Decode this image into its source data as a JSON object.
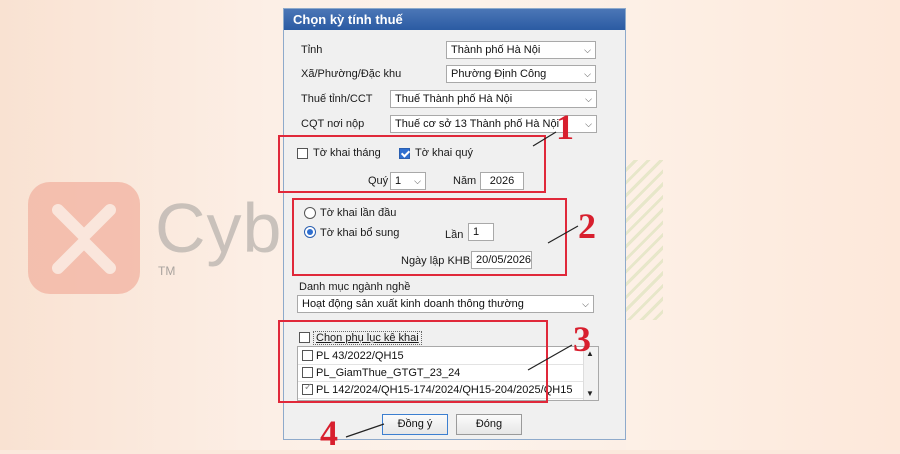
{
  "brand": {
    "name": "Cyber",
    "tm": "TM"
  },
  "dialog": {
    "title": "Chọn kỳ tính thuế",
    "fields": {
      "tinh": {
        "label": "Tỉnh",
        "value": "Thành phố Hà Nội"
      },
      "xa": {
        "label": "Xã/Phường/Đặc khu",
        "value": "Phường Định Công"
      },
      "thue": {
        "label": "Thuế tỉnh/CCT",
        "value": "Thuế Thành phố Hà Nội"
      },
      "cqt": {
        "label": "CQT nơi nộp",
        "value": "Thuế cơ sở 13 Thành phố Hà Nội"
      }
    },
    "period": {
      "monthly_label": "Tờ khai tháng",
      "monthly_checked": false,
      "quarterly_label": "Tờ khai quý",
      "quarterly_checked": true,
      "quarter_label": "Quý",
      "quarter_value": "1",
      "year_label": "Năm",
      "year_value": "2026"
    },
    "declaration": {
      "first_label": "Tờ khai lần đầu",
      "supplement_label": "Tờ khai bổ sung",
      "selected": "supplement",
      "times_label": "Lần",
      "times_value": "1",
      "date_label": "Ngày lập KHBS",
      "date_value": "20/05/2026"
    },
    "industry": {
      "label": "Danh mục ngành nghề",
      "value": "Hoạt động sản xuất kinh doanh thông thường"
    },
    "appendix": {
      "header_label": "Chọn phụ lục kê khai",
      "items": [
        {
          "label": "PL 43/2022/QH15",
          "checked": false
        },
        {
          "label": "PL_GiamThue_GTGT_23_24",
          "checked": false
        },
        {
          "label": "PL 142/2024/QH15-174/2024/QH15-204/2025/QH15",
          "checked": true
        }
      ]
    },
    "buttons": {
      "ok": "Đồng ý",
      "close": "Đóng"
    }
  },
  "annotations": [
    "1",
    "2",
    "3",
    "4"
  ],
  "colors": {
    "accent": "#2f6fd0",
    "title_bar": "#2b5ba3",
    "annotation": "#d81f2e"
  }
}
